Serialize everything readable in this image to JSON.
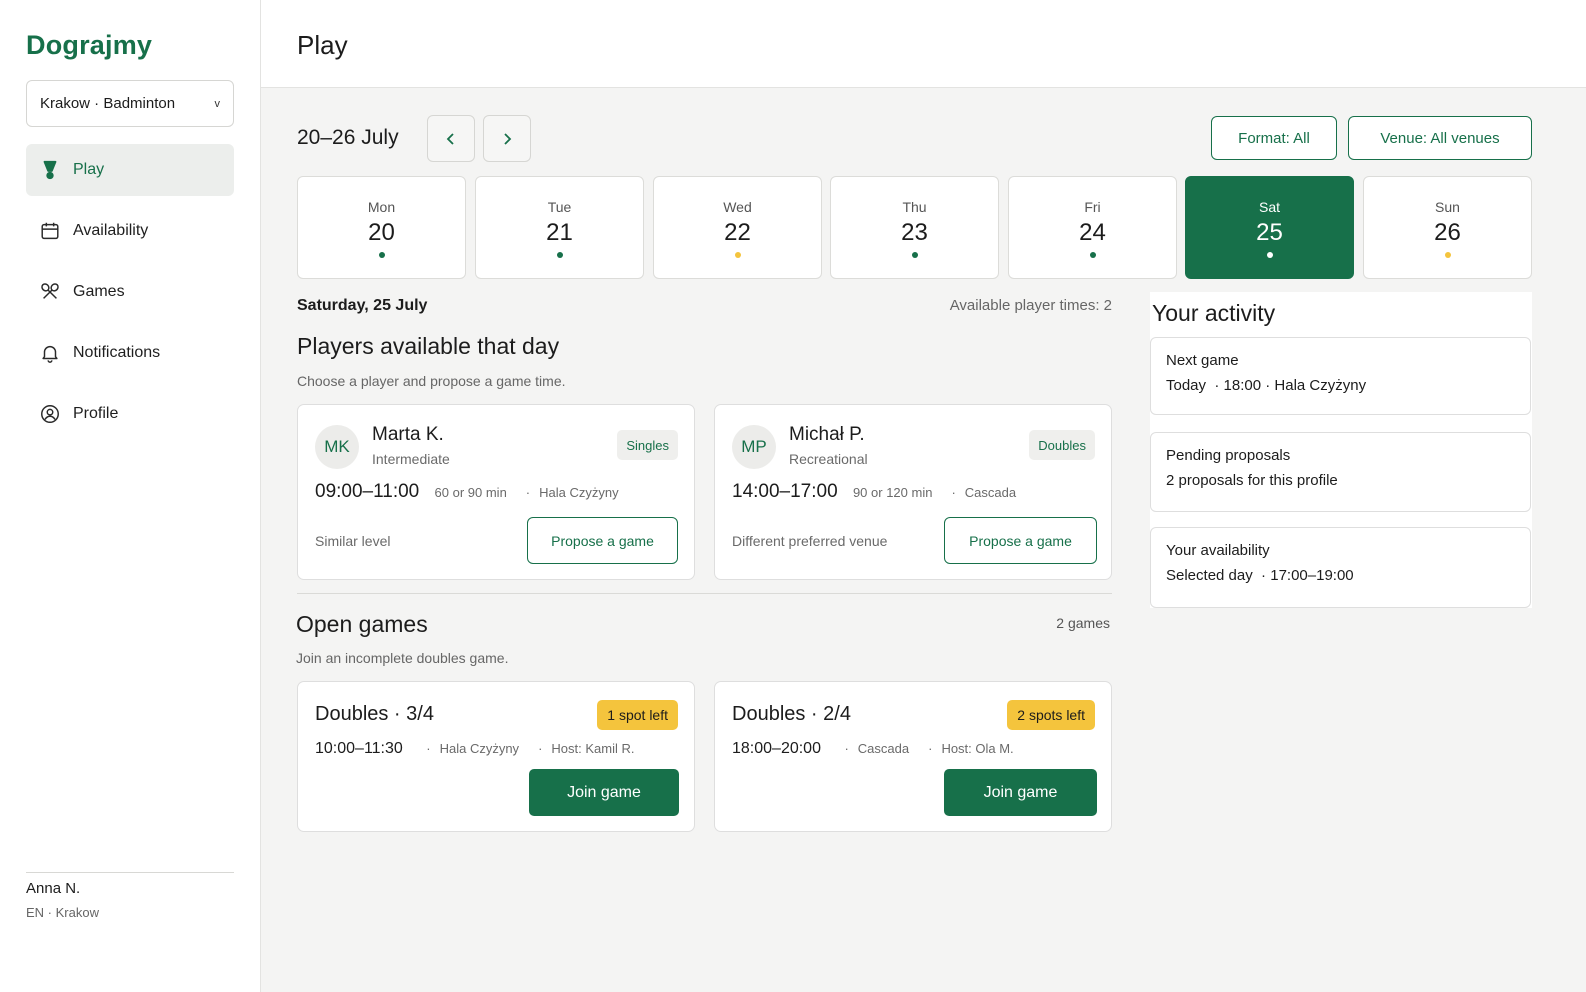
{
  "app": {
    "brand": "Dograjmy",
    "city_select": "Krakow · Badminton",
    "chevron": "v"
  },
  "nav": [
    {
      "label": "Play",
      "icon": "shuttlecock-icon",
      "active": true
    },
    {
      "label": "Availability",
      "icon": "calendar-icon",
      "active": false
    },
    {
      "label": "Games",
      "icon": "crossed-rackets-icon",
      "active": false
    },
    {
      "label": "Notifications",
      "icon": "bell-icon",
      "active": false
    },
    {
      "label": "Profile",
      "icon": "user-circle-icon",
      "active": false
    }
  ],
  "user": {
    "name": "Anna N.",
    "meta": "EN · Krakow"
  },
  "header": {
    "title": "Play"
  },
  "week": {
    "range": "20–26 July",
    "filters": {
      "format": "Format: All",
      "venue": "Venue: All venues"
    },
    "days": [
      {
        "name": "Mon",
        "num": "20",
        "dot": "#17704a",
        "selected": false
      },
      {
        "name": "Tue",
        "num": "21",
        "dot": "#17704a",
        "selected": false
      },
      {
        "name": "Wed",
        "num": "22",
        "dot": "#f4c43d",
        "selected": false
      },
      {
        "name": "Thu",
        "num": "23",
        "dot": "#17704a",
        "selected": false
      },
      {
        "name": "Fri",
        "num": "24",
        "dot": "#17704a",
        "selected": false
      },
      {
        "name": "Sat",
        "num": "25",
        "dot": "#ffffff",
        "selected": true
      },
      {
        "name": "Sun",
        "num": "26",
        "dot": "#f4c43d",
        "selected": false
      }
    ]
  },
  "selected_day": {
    "label": "Saturday, 25 July",
    "available_times": "Available player times: 2"
  },
  "players_section": {
    "title": "Players available that day",
    "subtitle": "Choose a player and propose a game time.",
    "players": [
      {
        "initials": "MK",
        "name": "Marta K.",
        "level": "Intermediate",
        "format": "Singles",
        "time": "09:00–11:00",
        "duration": "60 or 90 min",
        "venue": "Hala Czyżyny",
        "note": "Similar level",
        "action": "Propose a game"
      },
      {
        "initials": "MP",
        "name": "Michał P.",
        "level": "Recreational",
        "format": "Doubles",
        "time": "14:00–17:00",
        "duration": "90 or 120 min",
        "venue": "Cascada",
        "note": "Different preferred venue",
        "action": "Propose a game"
      }
    ]
  },
  "open_games": {
    "title": "Open games",
    "count": "2 games",
    "subtitle": "Join an incomplete doubles game.",
    "games": [
      {
        "title": "Doubles · 3/4",
        "spots": "1 spot left",
        "time": "10:00–11:30",
        "venue": "Hala Czyżyny",
        "host": "Host: Kamil R.",
        "action": "Join game"
      },
      {
        "title": "Doubles · 2/4",
        "spots": "2 spots left",
        "time": "18:00–20:00",
        "venue": "Cascada",
        "host": "Host: Ola M.",
        "action": "Join game"
      }
    ]
  },
  "activity": {
    "title": "Your activity",
    "cards": [
      {
        "label": "Next game",
        "value": "Today  · 18:00 · Hala Czyżyny"
      },
      {
        "label": "Pending proposals",
        "value": "2 proposals for this profile"
      },
      {
        "label": "Your availability",
        "value": "Selected day  · 17:00–19:00"
      }
    ]
  },
  "colors": {
    "brand": "#17704a",
    "warning": "#f4c43d",
    "background": "#f4f4f3"
  }
}
